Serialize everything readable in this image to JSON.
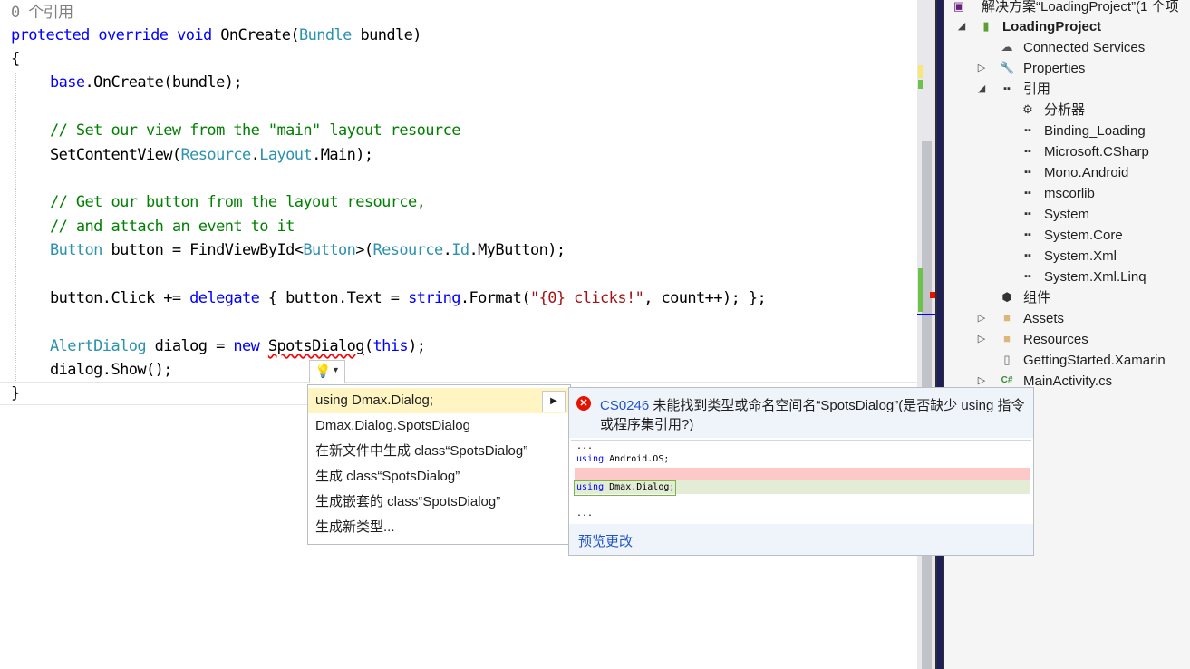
{
  "editor": {
    "codelens": "0 个引用",
    "lines": {
      "l1_a": "protected",
      "l1_b": "override",
      "l1_c": "void",
      "l1_d": "OnCreate(",
      "l1_e": "Bundle",
      "l1_f": " bundle)",
      "l2": "{",
      "l3_a": "base",
      "l3_b": ".OnCreate(bundle);",
      "l4": "// Set our view from the \"main\" layout resource",
      "l5_a": "SetContentView(",
      "l5_b": "Resource",
      "l5_c": ".",
      "l5_d": "Layout",
      "l5_e": ".Main);",
      "l6": "// Get our button from the layout resource,",
      "l7": "// and attach an event to it",
      "l8_a": "Button",
      "l8_b": " button = FindViewById<",
      "l8_c": "Button",
      "l8_d": ">(",
      "l8_e": "Resource",
      "l8_f": ".",
      "l8_g": "Id",
      "l8_h": ".MyButton);",
      "l9_a": "button.Click += ",
      "l9_b": "delegate",
      "l9_c": " { button.Text = ",
      "l9_d": "string",
      "l9_e": ".Format(",
      "l9_f": "\"{0} clicks!\"",
      "l9_g": ", count++); };",
      "l10_a": "AlertDialog",
      "l10_b": " dialog = ",
      "l10_c": "new",
      "l10_d": " ",
      "l10_e": "SpotsDialog",
      "l10_f": "(",
      "l10_g": "this",
      "l10_h": ");",
      "l11": "dialog.Show();",
      "l12": "}"
    }
  },
  "quick_actions": {
    "items": [
      "using Dmax.Dialog;",
      "Dmax.Dialog.SpotsDialog",
      "在新文件中生成 class“SpotsDialog”",
      "生成 class“SpotsDialog”",
      "生成嵌套的 class“SpotsDialog”",
      "生成新类型..."
    ],
    "submenu_arrow": "▶"
  },
  "preview": {
    "error_code": "CS0246",
    "error_message": " 未能找到类型或命名空间名“SpotsDialog”(是否缺少 using 指令或程序集引用?)",
    "ellipsis_top": "...",
    "line_using_os": "using Android.OS;",
    "line_using_dmax": "using Dmax.Dialog;",
    "ellipsis_bottom": "...",
    "preview_link": "预览更改"
  },
  "solution_explorer": {
    "solution_title": "解决方案“LoadingProject”(1 个项",
    "items": [
      {
        "label": "LoadingProject",
        "icon": "android-project-icon"
      },
      {
        "label": "Connected Services",
        "icon": "connected-services-icon"
      },
      {
        "label": "Properties",
        "icon": "wrench-icon"
      },
      {
        "label": "引用",
        "icon": "reference-icon"
      },
      {
        "label": "分析器",
        "icon": "analyzer-icon"
      },
      {
        "label": "Binding_Loading",
        "icon": "reference-icon"
      },
      {
        "label": "Microsoft.CSharp",
        "icon": "reference-icon"
      },
      {
        "label": "Mono.Android",
        "icon": "reference-icon"
      },
      {
        "label": "mscorlib",
        "icon": "reference-icon"
      },
      {
        "label": "System",
        "icon": "reference-icon"
      },
      {
        "label": "System.Core",
        "icon": "reference-icon"
      },
      {
        "label": "System.Xml",
        "icon": "reference-icon"
      },
      {
        "label": "System.Xml.Linq",
        "icon": "reference-icon"
      },
      {
        "label": "组件",
        "icon": "component-icon"
      },
      {
        "label": "Assets",
        "icon": "folder-icon"
      },
      {
        "label": "Resources",
        "icon": "folder-icon"
      },
      {
        "label": "GettingStarted.Xamarin",
        "icon": "file-icon"
      },
      {
        "label": "MainActivity.cs",
        "icon": "csharp-file-icon"
      }
    ]
  },
  "colors": {
    "keyword": "#0000ff",
    "type": "#2b91af",
    "comment": "#008000",
    "string": "#a31515",
    "error": "#e51400",
    "link": "#1f55c9"
  }
}
